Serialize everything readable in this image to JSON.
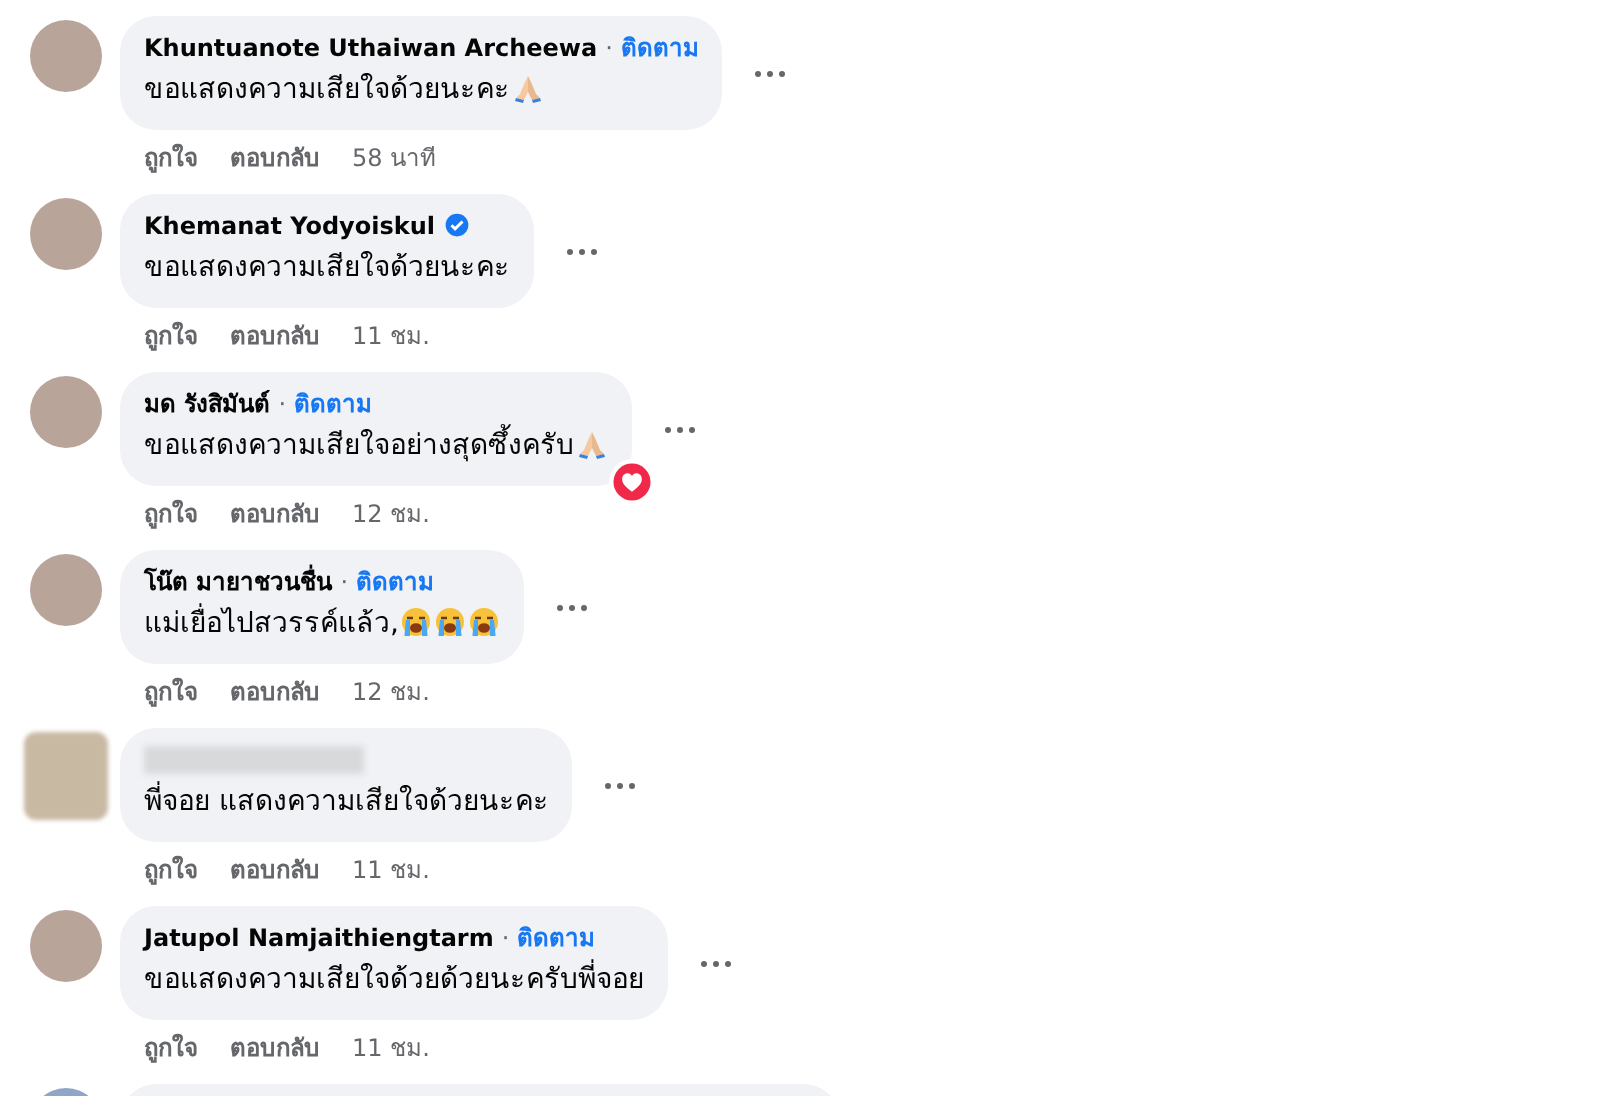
{
  "comments": [
    {
      "name": "Khuntuanote Uthaiwan Archeewa",
      "name_hidden": false,
      "verified": false,
      "separator": "·",
      "follow": "ติดตาม",
      "text": "ขอแสดงความเสียใจด้วยนะคะ",
      "emojis": [
        {
          "kind": "pray"
        }
      ],
      "loved": false,
      "like": "ถูกใจ",
      "reply": "ตอบกลับ",
      "time": "58 นาที"
    },
    {
      "name": "Khemanat Yodyoiskul",
      "name_hidden": false,
      "verified": true,
      "text": "ขอแสดงความเสียใจด้วยนะคะ",
      "loved": false,
      "like": "ถูกใจ",
      "reply": "ตอบกลับ",
      "time": "11 ชม."
    },
    {
      "name": "มด รังสิมันต์",
      "name_hidden": false,
      "verified": false,
      "separator": "·",
      "follow": "ติดตาม",
      "text": "ขอแสดงความเสียใจอย่างสุดซึ้งครับ",
      "emojis": [
        {
          "kind": "pray"
        }
      ],
      "loved": true,
      "like": "ถูกใจ",
      "reply": "ตอบกลับ",
      "time": "12 ชม."
    },
    {
      "name": "โน๊ต มายาชวนชื่น",
      "name_hidden": false,
      "verified": false,
      "separator": "·",
      "follow": "ติดตาม",
      "text": "แม่เยื่อไปสวรรค์แล้ว,",
      "emojis": [
        {
          "kind": "crying"
        },
        {
          "kind": "crying"
        },
        {
          "kind": "crying"
        }
      ],
      "loved": false,
      "like": "ถูกใจ",
      "reply": "ตอบกลับ",
      "time": "12 ชม."
    },
    {
      "name_hidden": true,
      "verified": false,
      "text": "พี่จอย แสดงความเสียใจด้วยนะคะ",
      "loved": false,
      "like": "ถูกใจ",
      "reply": "ตอบกลับ",
      "time": "11 ชม."
    },
    {
      "name": "Jatupol Namjaithiengtarm",
      "name_hidden": false,
      "verified": false,
      "separator": "·",
      "follow": "ติดตาม",
      "text": "ขอแสดงความเสียใจด้วยด้วยนะครับพี่จอย",
      "loved": false,
      "like": "ถูกใจ",
      "reply": "ตอบกลับ",
      "time": "11 ชม."
    }
  ],
  "next_comment_peek": true
}
